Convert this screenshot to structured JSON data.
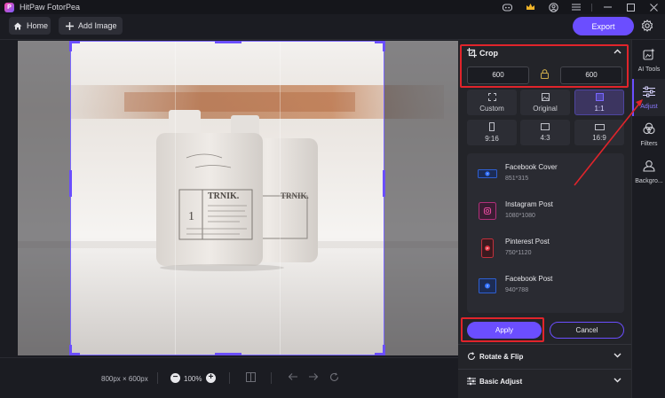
{
  "titlebar": {
    "app_title": "HitPaw FotorPea",
    "icons": [
      "discord-icon",
      "crown-icon",
      "user-icon",
      "menu-icon",
      "minimize-icon",
      "maximize-icon",
      "close-icon"
    ]
  },
  "toolbar": {
    "home_label": "Home",
    "add_image_label": "Add Image",
    "export_label": "Export"
  },
  "canvas": {
    "dimensions_text": "800px × 600px",
    "zoom_text": "100%"
  },
  "crop_panel": {
    "title": "Crop",
    "width_value": "600",
    "height_value": "600",
    "ratios": [
      {
        "label": "Custom",
        "icon": "custom-crop-icon"
      },
      {
        "label": "Original",
        "icon": "original-image-icon"
      },
      {
        "label": "1:1",
        "icon": "square-icon",
        "active": true
      },
      {
        "label": "9:16",
        "icon": "portrait-icon"
      },
      {
        "label": "4:3",
        "icon": "landscape-icon"
      },
      {
        "label": "16:9",
        "icon": "wide-icon"
      }
    ],
    "presets": [
      {
        "name": "Facebook Cover",
        "size": "851*315",
        "icon": "facebook-icon"
      },
      {
        "name": "Instagram Post",
        "size": "1080*1080",
        "icon": "instagram-icon"
      },
      {
        "name": "Pinterest Post",
        "size": "750*1120",
        "icon": "pinterest-icon"
      },
      {
        "name": "Facebook Post",
        "size": "940*788",
        "icon": "facebook-icon"
      }
    ],
    "apply_label": "Apply",
    "cancel_label": "Cancel"
  },
  "sections": {
    "rotate_flip": "Rotate & Flip",
    "basic_adjust": "Basic Adjust"
  },
  "sidebar": {
    "items": [
      {
        "label": "AI Tools",
        "icon": "ai-tools-icon"
      },
      {
        "label": "Adjust",
        "icon": "adjust-sliders-icon",
        "active": true
      },
      {
        "label": "Filters",
        "icon": "filters-icon"
      },
      {
        "label": "Backgro...",
        "icon": "background-icon"
      }
    ]
  },
  "colors": {
    "accent": "#6b4eff",
    "annotation_red": "#e0242b"
  }
}
